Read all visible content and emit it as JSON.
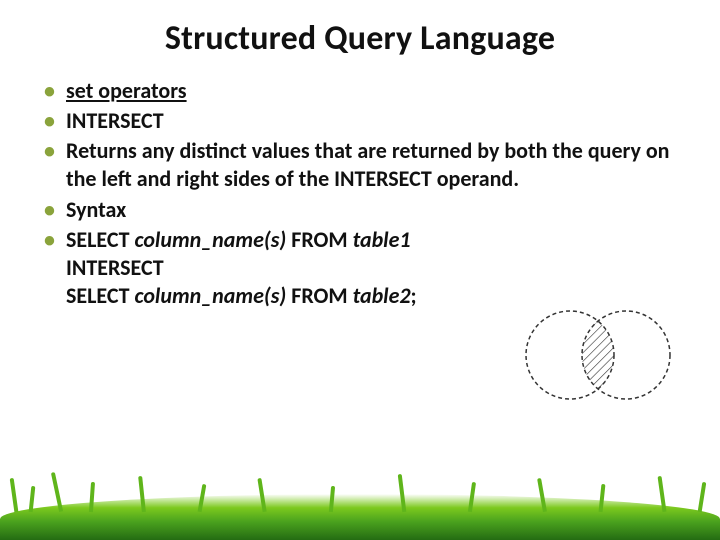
{
  "title": "Structured Query Language",
  "bullets": [
    {
      "text": "set operators",
      "underline": true
    },
    {
      "text": "INTERSECT"
    },
    {
      "text": "Returns any distinct values that are returned by both the query on the left and right sides of the INTERSECT operand."
    },
    {
      "text": "Syntax"
    },
    {
      "syntax": {
        "line1_a": "SELECT ",
        "line1_b": "column_name(s) ",
        "line1_c": "FROM ",
        "line1_d": "table1",
        "line2": "INTERSECT",
        "line3_a": "SELECT ",
        "line3_b": "column_name(s) ",
        "line3_c": "FROM ",
        "line3_d": "table2",
        "line3_e": ";"
      }
    }
  ]
}
